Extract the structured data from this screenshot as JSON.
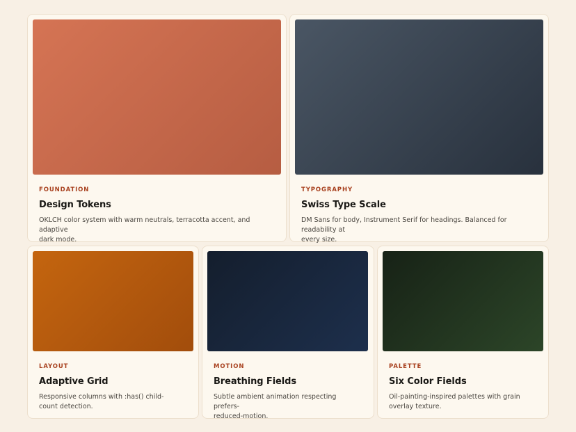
{
  "cards": [
    {
      "eyebrow": "FOUNDATION",
      "title": "Design Tokens",
      "description_lines": [
        "OKLCH color system with warm neutrals, terracotta accent, and adaptive",
        "dark mode."
      ],
      "swatch_colors": [
        "#d57454",
        "#b65d42"
      ]
    },
    {
      "eyebrow": "TYPOGRAPHY",
      "title": "Swiss Type Scale",
      "description_lines": [
        "DM Sans for body, Instrument Serif for headings. Balanced for readability at",
        "every size."
      ],
      "swatch_colors": [
        "#4a5664",
        "#28313d"
      ]
    },
    {
      "eyebrow": "LAYOUT",
      "title": "Adaptive Grid",
      "description_lines": [
        "Responsive columns with :has() child-",
        "count detection."
      ],
      "swatch_colors": [
        "#c4650f",
        "#a24d0c"
      ]
    },
    {
      "eyebrow": "MOTION",
      "title": "Breathing Fields",
      "description_lines": [
        "Subtle ambient animation respecting prefers-",
        "reduced-motion."
      ],
      "swatch_colors": [
        "#141e2d",
        "#1d2f4c"
      ]
    },
    {
      "eyebrow": "PALETTE",
      "title": "Six Color Fields",
      "description_lines": [
        "Oil-painting-inspired palettes with grain",
        "overlay texture."
      ],
      "swatch_colors": [
        "#172216",
        "#2c4528"
      ]
    }
  ],
  "colors": {
    "page_background": "#f8f0e5",
    "card_background": "#fdf8ef",
    "accent": "#a8411f"
  }
}
